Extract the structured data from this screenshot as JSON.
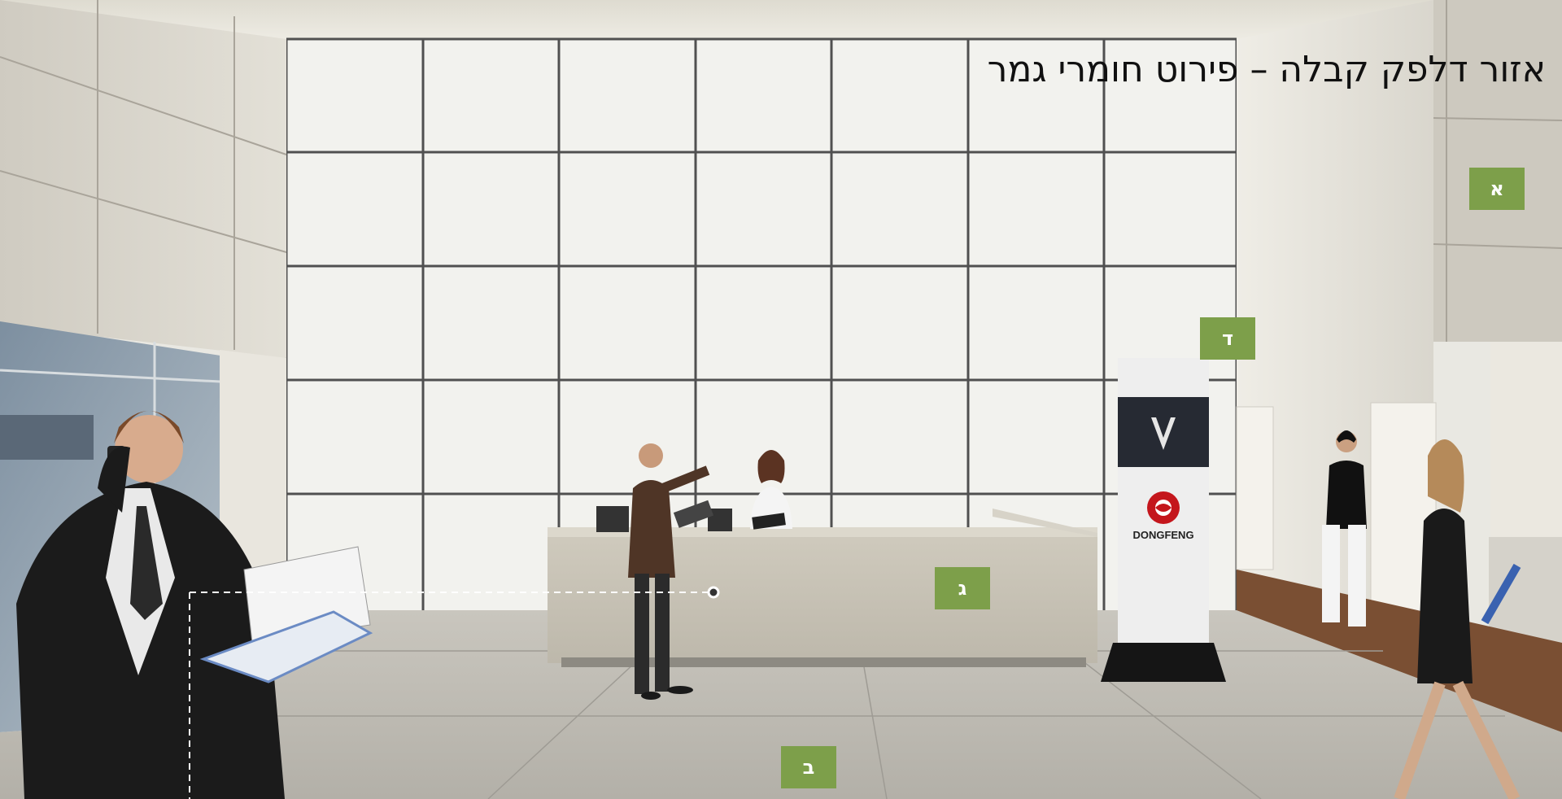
{
  "title": "אזור דלפק קבלה – פירוט חומרי גמר",
  "markers": [
    {
      "id": "a",
      "label": "א"
    },
    {
      "id": "b",
      "label": "ב"
    },
    {
      "id": "g",
      "label": "ג"
    },
    {
      "id": "d",
      "label": "ד"
    }
  ],
  "totem": {
    "brand": "DONGFENG"
  },
  "colors": {
    "marker": "#7d9f4a",
    "title": "#111111"
  }
}
